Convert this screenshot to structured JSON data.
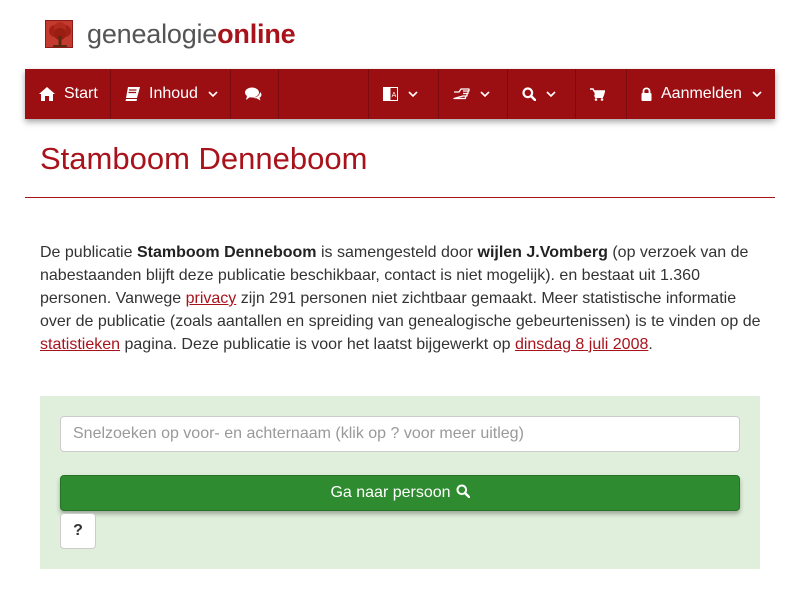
{
  "brand": {
    "name_part1": "genealogie",
    "name_part2": "online",
    "logo_icon": "tree-icon"
  },
  "colors": {
    "brand_red": "#a8131b",
    "navbar_bg": "#9b0f13",
    "panel_bg": "#e0efdc",
    "button_green": "#2f8b2f"
  },
  "navbar": {
    "start": {
      "icon": "home-icon",
      "label": "Start"
    },
    "inhoud": {
      "icon": "book-icon",
      "label": "Inhoud"
    },
    "chat": {
      "icon": "comments-icon"
    },
    "language": {
      "icon": "language-icon"
    },
    "hand": {
      "icon": "hand-pointer-icon"
    },
    "search": {
      "icon": "search-icon"
    },
    "cart": {
      "icon": "shopping-cart-icon"
    },
    "login": {
      "icon": "lock-icon",
      "label": "Aanmelden"
    }
  },
  "page": {
    "title": "Stamboom Denneboom"
  },
  "intro": {
    "t1": "De publicatie ",
    "pub_name": "Stamboom Denneboom",
    "t2": " is samengesteld door ",
    "author": "wijlen J.Vomberg",
    "t3": " (op verzoek van de nabestaanden blijft deze publicatie beschikbaar, contact is niet mogelijk). en bestaat uit 1.360 personen. Vanwege ",
    "privacy_link": "privacy",
    "t4": " zijn 291 personen niet zichtbaar gemaakt. Meer statistische informatie over de publicatie (zoals aantallen en spreiding van genealogische gebeurtenissen) is te vinden op de ",
    "stats_link": "statistieken",
    "t5": " pagina. Deze publicatie is voor het laatst bijgewerkt op ",
    "date_link": "dinsdag 8 juli 2008",
    "t6": "."
  },
  "search": {
    "placeholder": "Snelzoeken op voor- en achternaam (klik op ? voor meer uitleg)",
    "value": "",
    "go_label": "Ga naar persoon",
    "help_label": "?"
  }
}
